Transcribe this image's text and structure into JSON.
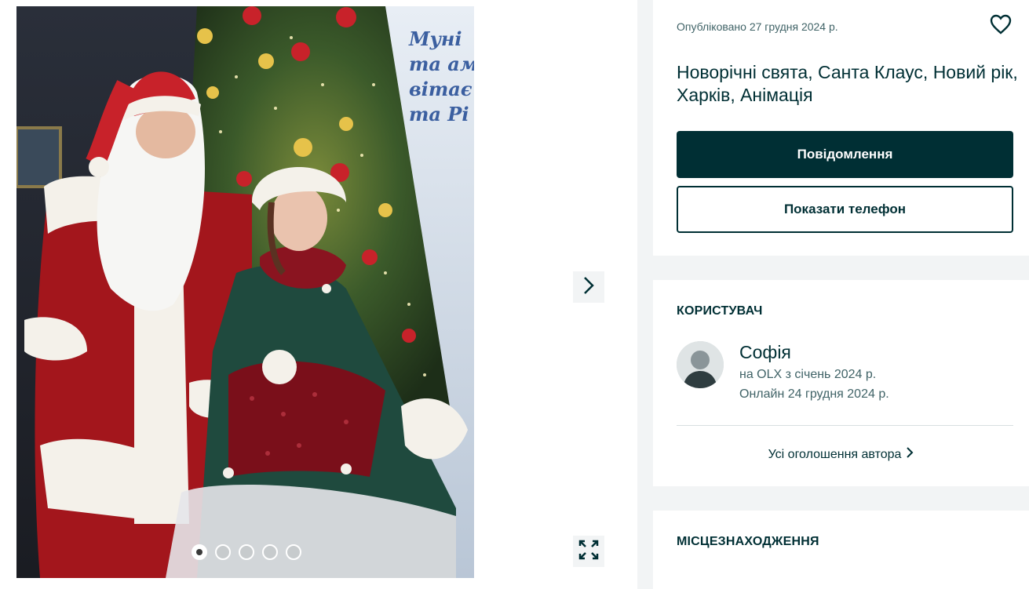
{
  "gallery": {
    "image_alt": "Дід Мороз та Снігурочка біля новорічної ялинки",
    "next_icon": "chevron-right-icon",
    "fullscreen_icon": "expand-icon",
    "dots": [
      {
        "active": true
      },
      {
        "active": false
      },
      {
        "active": false
      },
      {
        "active": false
      },
      {
        "active": false
      }
    ]
  },
  "ad": {
    "posted": "Опубліковано 27 грудня 2024 р.",
    "favorite_icon": "heart-icon",
    "title": "Новорічні свята, Санта Клаус, Новий рік, Харків, Анімація",
    "message_button": "Повідомлення",
    "phone_button": "Показати телефон"
  },
  "user": {
    "heading": "КОРИСТУВАЧ",
    "name": "Софія",
    "since": "на OLX з січень 2024 р.",
    "online": "Онлайн 24 грудня 2024 р.",
    "all_ads": "Усі оголошення автора"
  },
  "location": {
    "heading": "МІСЦЕЗНАХОДЖЕННЯ"
  },
  "colors": {
    "primary": "#002f34",
    "muted": "#406367",
    "background": "#f2f4f5",
    "card": "#ffffff"
  }
}
